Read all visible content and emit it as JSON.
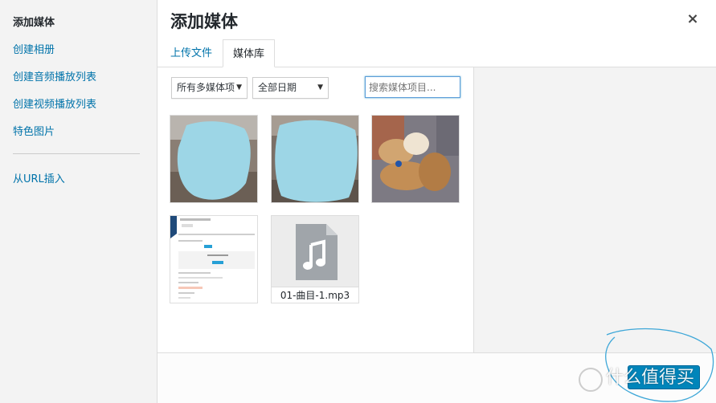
{
  "sidebar": {
    "items": [
      {
        "label": "添加媒体",
        "active": true
      },
      {
        "label": "创建相册"
      },
      {
        "label": "创建音频播放列表"
      },
      {
        "label": "创建视频播放列表"
      },
      {
        "label": "特色图片"
      }
    ],
    "url_item": "从URL插入"
  },
  "header": {
    "title": "添加媒体",
    "close_glyph": "×"
  },
  "tabs": {
    "upload": "上传文件",
    "library": "媒体库"
  },
  "filters": {
    "type_select": "所有多媒体项",
    "date_select": "全部日期",
    "arrow": "▼",
    "search_placeholder": "搜索媒体项目..."
  },
  "media": {
    "audio_filename": "01-曲目-1.mp3"
  },
  "footer": {
    "insert_button": "",
    "watermark": "什么值得买"
  },
  "colors": {
    "link": "#0073aa",
    "button": "#0085ba",
    "scribble": "#8fd3e8"
  }
}
